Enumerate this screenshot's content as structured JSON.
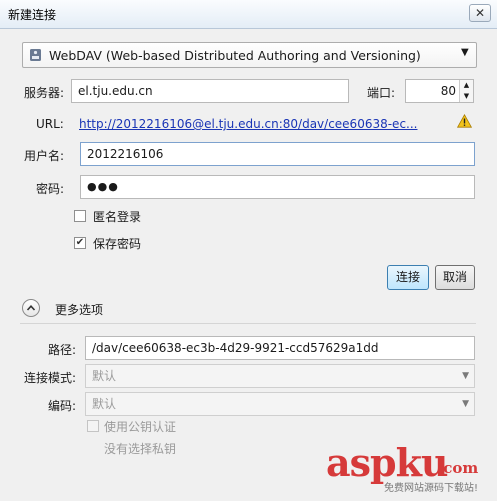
{
  "window": {
    "title": "新建连接"
  },
  "protocol": {
    "selected": "WebDAV (Web-based Distributed Authoring and Versioning)"
  },
  "server": {
    "label": "服务器:",
    "value": "el.tju.edu.cn"
  },
  "port": {
    "label": "端口:",
    "value": "80"
  },
  "url": {
    "label": "URL:",
    "value": "http://2012216106@el.tju.edu.cn:80/dav/cee60638-ec..."
  },
  "username": {
    "label": "用户名:",
    "value": "2012216106"
  },
  "password": {
    "label": "密码:",
    "value": "●●●"
  },
  "anonymous": {
    "label": "匿名登录",
    "checked": false
  },
  "save_password": {
    "label": "保存密码",
    "checked": true
  },
  "buttons": {
    "connect": "连接",
    "cancel": "取消"
  },
  "more_options": {
    "label": "更多选项"
  },
  "path": {
    "label": "路径:",
    "value": "/dav/cee60638-ec3b-4d29-9921-ccd57629a1dd"
  },
  "connect_mode": {
    "label": "连接模式:",
    "value": "默认"
  },
  "encoding": {
    "label": "编码:",
    "value": "默认"
  },
  "public_key": {
    "label": "使用公钥认证",
    "checked": false
  },
  "private_key": {
    "label": "没有选择私钥"
  },
  "watermark": {
    "brand": "aspku",
    "tld": ".com",
    "tagline": "免费网站源码下载站!"
  },
  "colors": {
    "link": "#1a35b5",
    "warning": "#e8b400",
    "watermark": "#d63a3a"
  },
  "icons": {
    "protocol": "disk-icon",
    "warning": "warning-icon",
    "expand": "chevron-up-icon"
  }
}
